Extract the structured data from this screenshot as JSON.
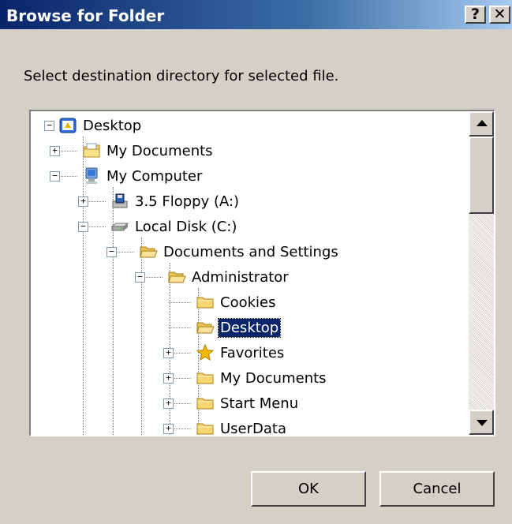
{
  "window": {
    "title": "Browse for Folder",
    "help_label": "?",
    "close_label": "✕"
  },
  "instruction": "Select destination directory for selected file.",
  "tree": {
    "items": [
      {
        "label": "Desktop",
        "icon": "desktop-icon",
        "expander": "−"
      },
      {
        "label": "My Documents",
        "icon": "my-documents-icon",
        "expander": "+"
      },
      {
        "label": "My Computer",
        "icon": "my-computer-icon",
        "expander": "−"
      },
      {
        "label": "3.5 Floppy (A:)",
        "icon": "floppy-drive-icon",
        "expander": "+"
      },
      {
        "label": "Local Disk (C:)",
        "icon": "hard-disk-icon",
        "expander": "−"
      },
      {
        "label": "Documents and Settings",
        "icon": "folder-open-icon",
        "expander": "−"
      },
      {
        "label": "Administrator",
        "icon": "folder-open-icon",
        "expander": "−"
      },
      {
        "label": "Cookies",
        "icon": "folder-icon",
        "expander": ""
      },
      {
        "label": "Desktop",
        "icon": "folder-open-icon",
        "expander": "",
        "selected": true
      },
      {
        "label": "Favorites",
        "icon": "favorites-star-icon",
        "expander": "+"
      },
      {
        "label": "My Documents",
        "icon": "folder-icon",
        "expander": "+"
      },
      {
        "label": "Start Menu",
        "icon": "folder-icon",
        "expander": "+"
      },
      {
        "label": "UserData",
        "icon": "folder-icon",
        "expander": "+"
      }
    ]
  },
  "buttons": {
    "ok": "OK",
    "cancel": "Cancel"
  },
  "colors": {
    "titlebar_start": "#0a246a",
    "titlebar_end": "#a6caf0",
    "selection": "#0a246a",
    "dialog_face": "#d4d0c8"
  }
}
